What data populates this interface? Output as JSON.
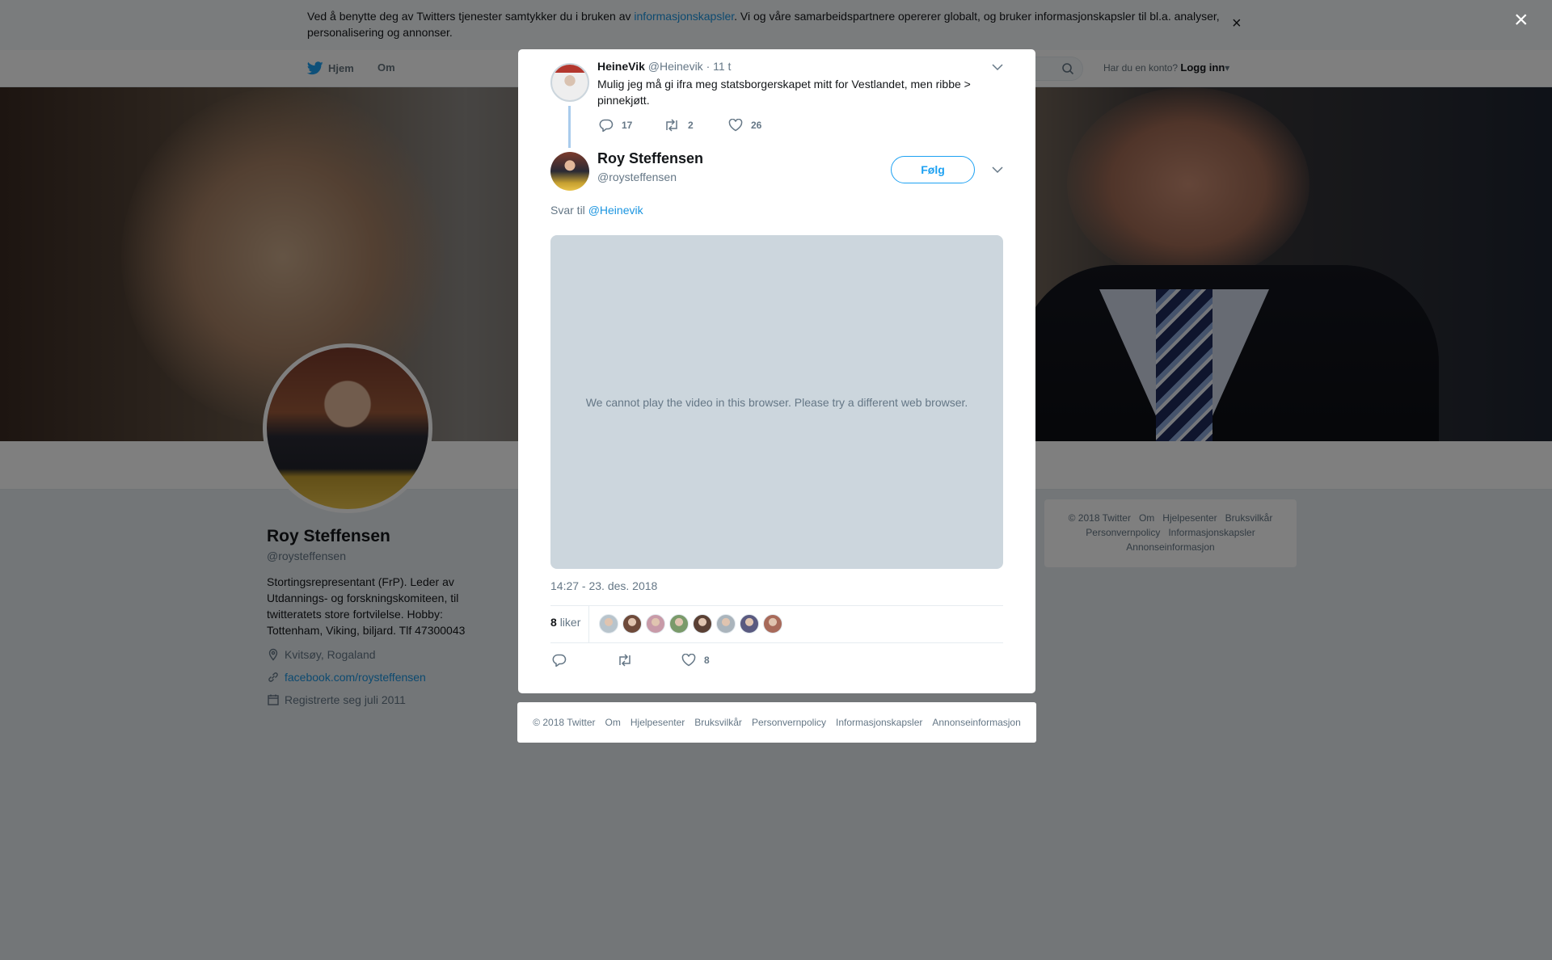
{
  "cookie_banner": {
    "text_before": "Ved å benytte deg av Twitters tjenester samtykker du i bruken av ",
    "link": "informasjonskapsler",
    "text_after": ". Vi og våre samarbeidspartnere opererer globalt, og bruker informasjonskapsler til bl.a. analyser, personalisering og annonser.",
    "close": "×"
  },
  "nav": {
    "home": "Hjem",
    "about": "Om",
    "account_prompt": "Har du en konto?",
    "login": "Logg inn"
  },
  "profile": {
    "name": "Roy Steffensen",
    "handle": "@roysteffensen",
    "bio": "Stortingsrepresentant (FrP). Leder av Utdannings- og forskningskomiteen, til twitteratets store fortvilelse. Hobby: Tottenham, Viking, biljard. Tlf 47300043",
    "location": "Kvitsøy, Rogaland",
    "website": "facebook.com/roysteffensen",
    "joined": "Registrerte seg juli 2011"
  },
  "side_footer": {
    "links": [
      "© 2018 Twitter",
      "Om",
      "Hjelpesenter",
      "Bruksvilkår",
      "Personvernpolicy",
      "Informasjonskapsler",
      "Annonseinformasjon"
    ]
  },
  "overlay_close": "×",
  "modal": {
    "parent_tweet": {
      "name": "HeineVik",
      "handle": "@Heinevik",
      "time": "· 11 t",
      "text": "Mulig jeg må gi ifra meg statsborgerskapet mitt for Vestlandet, men ribbe > pinnekjøtt.",
      "replies": "17",
      "retweets": "2",
      "likes": "26"
    },
    "tweet": {
      "name": "Roy Steffensen",
      "handle": "@roysteffensen",
      "follow_label": "Følg",
      "reply_to_prefix": "Svar til",
      "reply_to_handle": "@Heinevik",
      "video_message": "We cannot play the video in this browser. Please try a different web browser.",
      "timestamp": "14:27 - 23. des. 2018",
      "likes_count": "8",
      "likes_label": "liker",
      "retweets": "",
      "likes": "8"
    },
    "footer_links": [
      "© 2018 Twitter",
      "Om",
      "Hjelpesenter",
      "Bruksvilkår",
      "Personvernpolicy",
      "Informasjonskapsler",
      "Annonseinformasjon"
    ]
  },
  "colors": {
    "accent": "#1da1f2",
    "link": "#1b95e0",
    "muted": "#657786",
    "thread_line": "#a9ccec",
    "liker_avatars": [
      "#b8c4cc",
      "#6e4a3a",
      "#c89aa8",
      "#7a9a6a",
      "#5a4034",
      "#aab4bc",
      "#5a5a80",
      "#a86a5a"
    ]
  }
}
